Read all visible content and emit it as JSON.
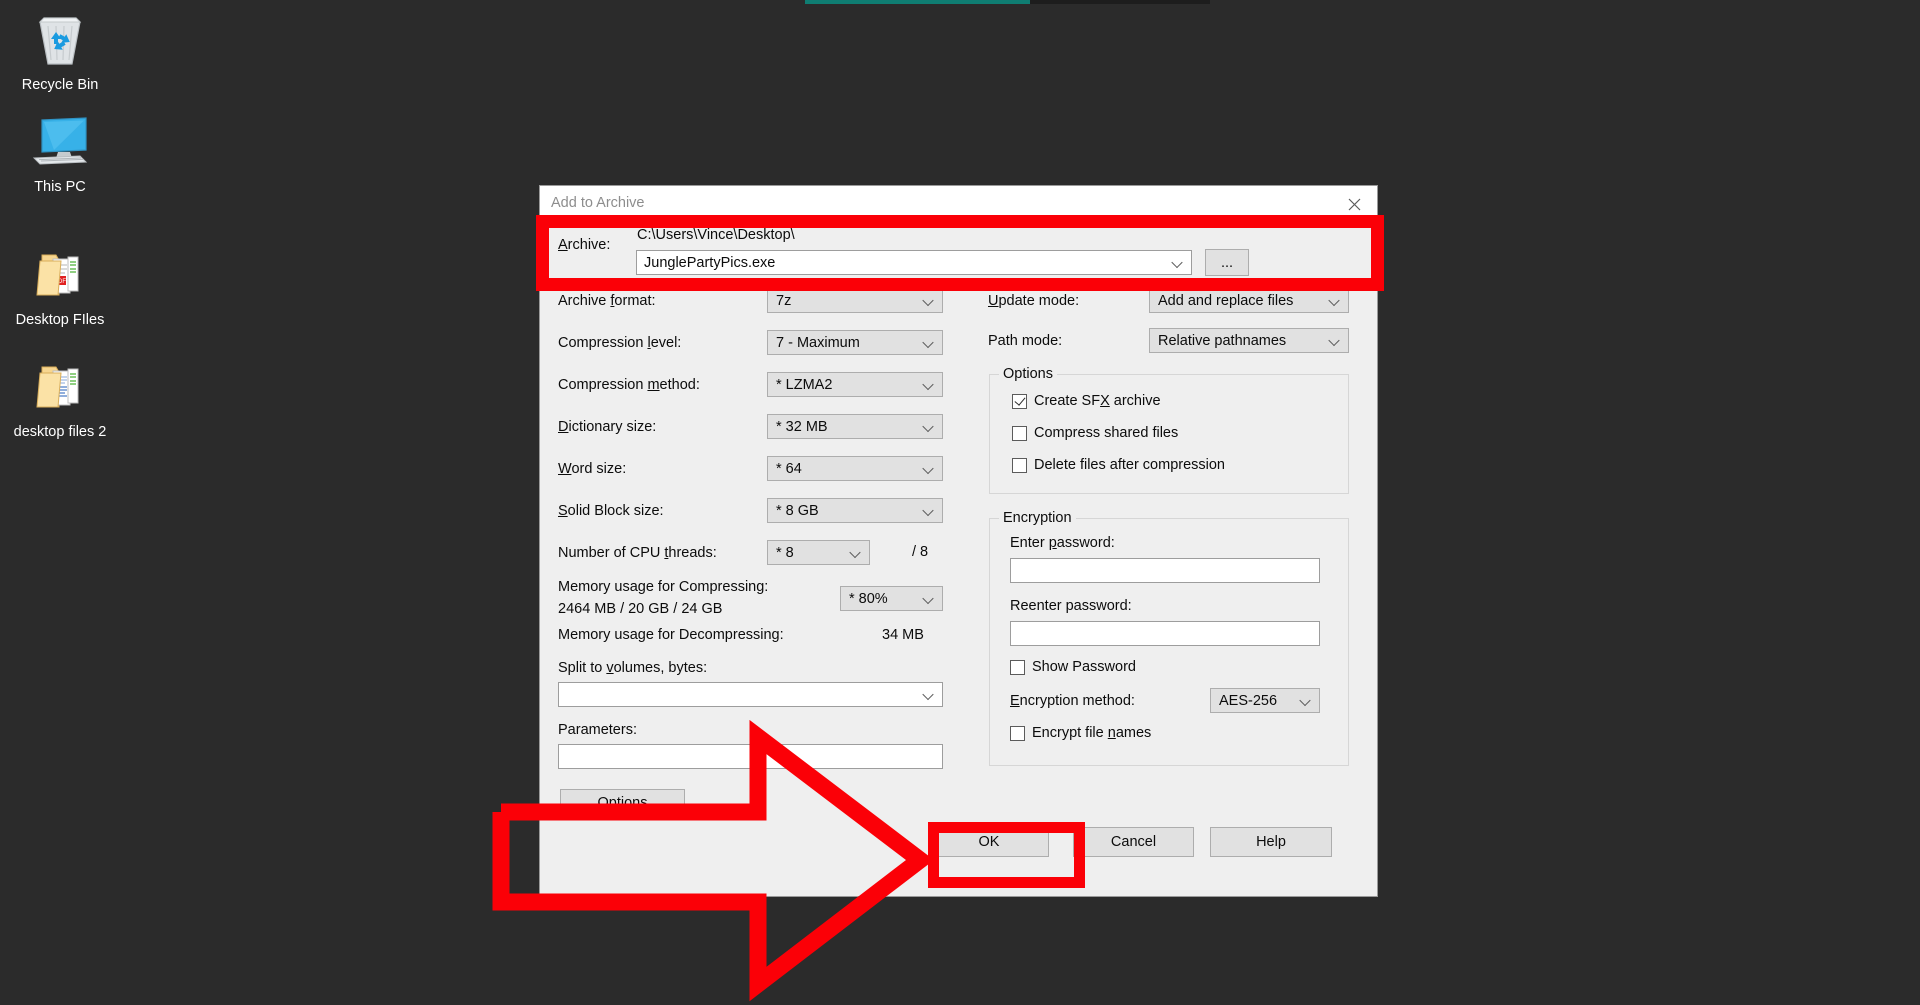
{
  "desktop": {
    "background_color": "#2b2b2b",
    "icons": [
      {
        "name": "Recycle Bin",
        "icon": "recycle-bin-icon"
      },
      {
        "name": "This PC",
        "icon": "this-pc-icon"
      },
      {
        "name": "Desktop FIles",
        "icon": "folder-pdf-icon"
      },
      {
        "name": "desktop files 2",
        "icon": "folder-docs-icon"
      }
    ]
  },
  "dialog": {
    "title": "Add to Archive",
    "close_icon": "close-icon",
    "archive": {
      "label": "Archive:",
      "label_accel": "A",
      "path_text": "C:\\Users\\Vince\\Desktop\\",
      "filename_value": "JunglePartyPics.exe",
      "browse_label": "..."
    },
    "left_fields": [
      {
        "label": "Archive format:",
        "accel": "f",
        "value": "7z"
      },
      {
        "label": "Compression level:",
        "accel": "l",
        "value": "7 - Maximum"
      },
      {
        "label": "Compression method:",
        "accel": "m",
        "value": "* LZMA2"
      },
      {
        "label": "Dictionary size:",
        "accel": "D",
        "value": "* 32 MB"
      },
      {
        "label": "Word size:",
        "accel": "W",
        "value": "* 64"
      },
      {
        "label": "Solid Block size:",
        "accel": "S",
        "value": "* 8 GB"
      },
      {
        "label": "Number of CPU threads:",
        "accel": "t",
        "value": "* 8"
      }
    ],
    "cpu_threads_total": "/ 8",
    "memory": {
      "compress_label": "Memory usage for Compressing:",
      "compress_value": "2464 MB / 20 GB / 24 GB",
      "compress_percent": "* 80%",
      "decompress_label": "Memory usage for Decompressing:",
      "decompress_value": "34 MB"
    },
    "split": {
      "label": "Split to volumes, bytes:",
      "accel": "v",
      "value": ""
    },
    "parameters": {
      "label": "Parameters:",
      "value": ""
    },
    "options_button": "Options",
    "right_fields": [
      {
        "label": "Update mode:",
        "accel": "U",
        "value": "Add and replace files"
      },
      {
        "label": "Path mode:",
        "accel": "",
        "value": "Relative pathnames"
      }
    ],
    "options_group": {
      "title": "Options",
      "items": [
        {
          "label": "Create SFX archive",
          "accel": "X",
          "checked": true
        },
        {
          "label": "Compress shared files",
          "accel": "",
          "checked": false
        },
        {
          "label": "Delete files after compression",
          "accel": "",
          "checked": false
        }
      ]
    },
    "encryption_group": {
      "title": "Encryption",
      "enter_password_label": "Enter password:",
      "enter_password_accel": "p",
      "enter_password_value": "",
      "reenter_password_label": "Reenter password:",
      "reenter_password_value": "",
      "show_password_label": "Show Password",
      "show_password_checked": false,
      "method_label": "Encryption method:",
      "method_accel": "E",
      "method_value": "AES-256",
      "encrypt_names_label": "Encrypt file names",
      "encrypt_names_accel": "n",
      "encrypt_names_checked": false
    },
    "buttons": {
      "ok": "OK",
      "cancel": "Cancel",
      "help": "Help"
    }
  },
  "annotations": {
    "highlight_color": "#fb0007",
    "arrow_direction": "right",
    "boxes": [
      {
        "target": "archive-field-row"
      },
      {
        "target": "ok-button"
      }
    ]
  }
}
